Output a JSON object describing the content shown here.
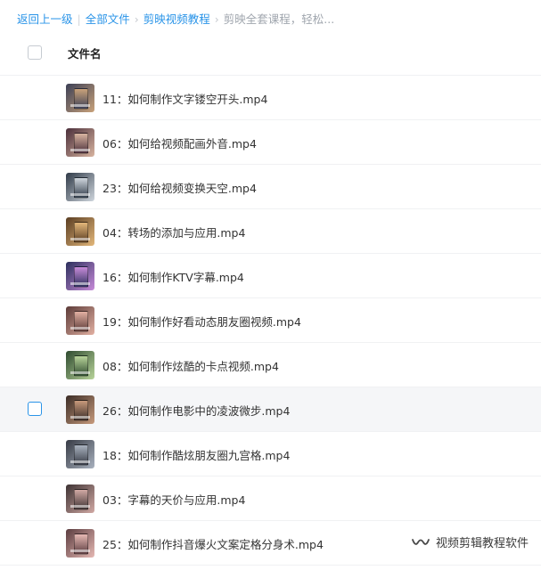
{
  "breadcrumb": {
    "back": "返回上一级",
    "all_files": "全部文件",
    "folder": "剪映视频教程",
    "current": "剪映全套课程，轻松..."
  },
  "list": {
    "header_label": "文件名",
    "files": [
      {
        "name": "11：如何制作文字镂空开头.mp4",
        "thumb_colors": [
          "#3b3f55",
          "#c9a27a"
        ]
      },
      {
        "name": "06：如何给视频配画外音.mp4",
        "thumb_colors": [
          "#4a2e3a",
          "#d8b4a0"
        ]
      },
      {
        "name": "23：如何给视频变换天空.mp4",
        "thumb_colors": [
          "#2f3a48",
          "#cfd6dd"
        ]
      },
      {
        "name": "04：转场的添加与应用.mp4",
        "thumb_colors": [
          "#5a3d22",
          "#e3b77a"
        ]
      },
      {
        "name": "16：如何制作KTV字幕.mp4",
        "thumb_colors": [
          "#2b2f5c",
          "#c78bd9"
        ]
      },
      {
        "name": "19：如何制作好看动态朋友圈视频.mp4",
        "thumb_colors": [
          "#5c3b38",
          "#e2b0a2"
        ]
      },
      {
        "name": "08：如何制作炫酷的卡点视频.mp4",
        "thumb_colors": [
          "#2e4a2f",
          "#b8d49a"
        ]
      },
      {
        "name": "26：如何制作电影中的凌波微步.mp4",
        "thumb_colors": [
          "#3a2c26",
          "#c79a7c"
        ]
      },
      {
        "name": "18：如何制作酷炫朋友圈九宫格.mp4",
        "thumb_colors": [
          "#363a44",
          "#a9b2bf"
        ]
      },
      {
        "name": "03：字幕的天价与应用.mp4",
        "thumb_colors": [
          "#3d3233",
          "#d1a9a4"
        ]
      },
      {
        "name": "25：如何制作抖音爆火文案定格分身术.mp4",
        "thumb_colors": [
          "#5b3c3f",
          "#e6b9b4"
        ]
      }
    ],
    "hover_index": 7
  },
  "watermark": {
    "text": "视频剪辑教程软件",
    "icon": "wechat-channel-icon"
  },
  "colors": {
    "link": "#2a94e8",
    "muted": "#a0a6ae",
    "row_hover": "#f5f6f8",
    "divider": "#f0f1f3"
  }
}
